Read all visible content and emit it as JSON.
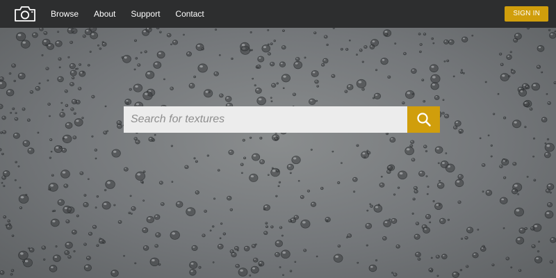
{
  "colors": {
    "topbar_bg": "#2d2e2f",
    "accent": "#d09e0c",
    "nav_text": "#ffffff",
    "search_bg": "#ececec"
  },
  "header": {
    "logo_icon": "camera-icon",
    "nav": [
      {
        "label": "Browse"
      },
      {
        "label": "About"
      },
      {
        "label": "Support"
      },
      {
        "label": "Contact"
      }
    ],
    "signin_label": "SIGN IN"
  },
  "hero": {
    "background": "raindrops-on-glass",
    "search": {
      "placeholder": "Search for textures",
      "value": "",
      "button_icon": "search-icon"
    }
  }
}
